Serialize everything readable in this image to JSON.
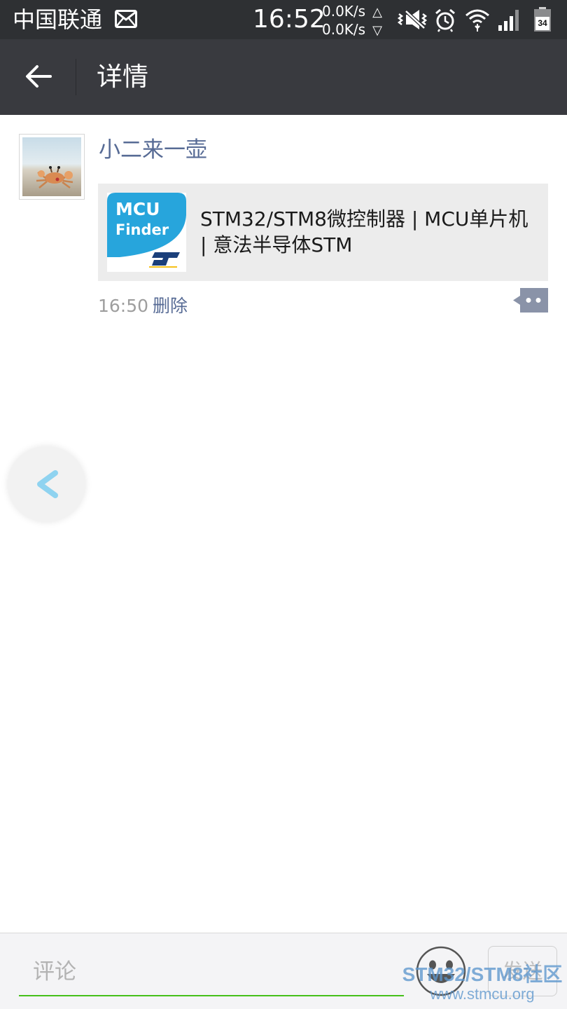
{
  "status_bar": {
    "carrier": "中国联通",
    "time": "16:52",
    "upload_speed": "0.0K/s",
    "download_speed": "0.0K/s",
    "upload_arrow": "△",
    "download_arrow": "▽",
    "battery_level": "34",
    "icons": [
      "mail-icon",
      "vibrate-mute-icon",
      "alarm-icon",
      "wifi-icon",
      "signal-icon",
      "battery-icon"
    ]
  },
  "title_bar": {
    "title": "详情"
  },
  "post": {
    "author": "小二来一壶",
    "link": {
      "thumb_line1": "MCU",
      "thumb_line2": "Finder",
      "thumb_brand": "ST",
      "title": "STM32/STM8微控制器 | MCU单片机 | 意法半导体STM"
    },
    "time": "16:50",
    "delete_label": "删除"
  },
  "comment_bar": {
    "placeholder": "评论",
    "send_label": "发送"
  },
  "watermark": {
    "line1": "STM32/STM8社区",
    "line2": "www.stmcu.org"
  },
  "colors": {
    "status_bar_bg": "#2e3033",
    "title_bar_bg": "#393a3f",
    "name_link": "#576b95",
    "input_underline": "#45c01a",
    "card_bg": "#ececec",
    "mcu_blue": "#27a5dc"
  }
}
